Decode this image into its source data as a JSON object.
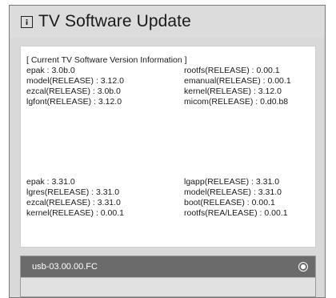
{
  "dialog": {
    "title": "TV Software Update",
    "icon": "info-icon"
  },
  "current_version": {
    "section_title": "[ Current TV Software Version Information ]",
    "left": [
      "epak : 3.0b.0",
      "model(RELEASE) : 3.12.0",
      "ezcal(RELEASE) : 3.0b.0",
      "lgfont(RELEASE) : 3.12.0"
    ],
    "right": [
      "rootfs(RELEASE) : 0.00.1",
      "emanual(RELEASE) : 0.00.1",
      "kernel(RELEASE) : 3.12.0",
      "micom(RELEASE) : 0.d0.b8"
    ]
  },
  "update_version": {
    "left": [
      "epak : 3.31.0",
      "lgres(RELEASE) : 3.31.0",
      "ezcal(RELEASE) : 3.31.0",
      "kernel(RELEASE) : 0.00.1"
    ],
    "right": [
      "lgapp(RELEASE) : 3.31.0",
      "model(RELEASE) : 3.31.0",
      "boot(RELEASE) : 0.00.1",
      "rootfs(REA/LEASE) : 0.00.1"
    ]
  },
  "usb_list": {
    "items": [
      {
        "label": "usb-03.00.00.FC",
        "selected": true
      }
    ]
  },
  "colors": {
    "dialog_bg": "#d9d9d9",
    "panel_bg": "#ffffff",
    "selected_item_bg": "#6b6b6b",
    "selected_item_text": "#ffffff"
  }
}
